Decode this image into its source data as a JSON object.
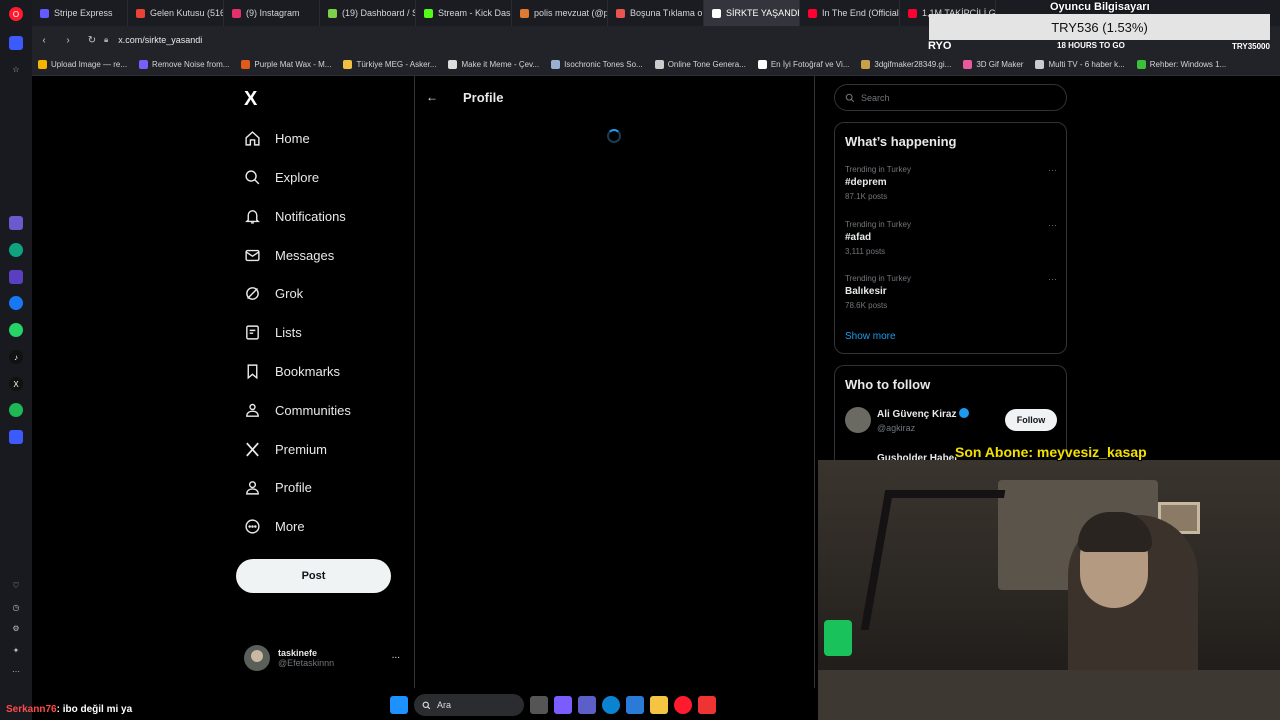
{
  "browser": {
    "tabs": [
      {
        "label": "Stripe Express",
        "color": "#635bff"
      },
      {
        "label": "Gelen Kutusu (516) -",
        "color": "#ea4335"
      },
      {
        "label": "(9) Instagram",
        "color": "#e1306c"
      },
      {
        "label": "(19) Dashboard / Str",
        "color": "#7bd148"
      },
      {
        "label": "Stream - Kick Dashbo",
        "color": "#53fc18"
      },
      {
        "label": "polis mevzuat (@poli",
        "color": "#e07a30"
      },
      {
        "label": "Boşuna Tıklama on X",
        "color": "#e8554e"
      },
      {
        "label": "SİRKTE YAŞANDI (@sirkt",
        "color": "#ffffff"
      },
      {
        "label": "In The End (Official H",
        "color": "#ff0033"
      },
      {
        "label": "1,1M TAKİPÇİLİ GLOB",
        "color": "#ff0033"
      }
    ],
    "url": "x.com/sirkte_yasandi",
    "bookmarks": [
      {
        "label": "Upload Image — re...",
        "color": "#f5b400"
      },
      {
        "label": "Remove Noise from...",
        "color": "#7a5cff"
      },
      {
        "label": "Purple Mat Wax - M...",
        "color": "#e05a1a"
      },
      {
        "label": "Türkiye MEG - Asker...",
        "color": "#f0c040"
      },
      {
        "label": "Make it Meme - Çev...",
        "color": "#dddddd"
      },
      {
        "label": "Isochronic Tones So...",
        "color": "#9ab0d0"
      },
      {
        "label": "Online Tone Genera...",
        "color": "#cccccc"
      },
      {
        "label": "En İyi Fotoğraf ve Vi...",
        "color": "#ffffff"
      },
      {
        "label": "3dgifmaker28349.gi...",
        "color": "#c8a04a"
      },
      {
        "label": "3D Gif Maker",
        "color": "#e85a9a"
      },
      {
        "label": "Multi TV - 6 haber k...",
        "color": "#cccccc"
      },
      {
        "label": "Rehber: Windows 1...",
        "color": "#3ac03a"
      }
    ]
  },
  "nav": {
    "logo": "X",
    "items": [
      "Home",
      "Explore",
      "Notifications",
      "Messages",
      "Grok",
      "Lists",
      "Bookmarks",
      "Communities",
      "Premium",
      "Profile",
      "More"
    ],
    "post_label": "Post",
    "account": {
      "name": "taskinefe",
      "handle": "@Efetaskinnn",
      "more": "..."
    }
  },
  "main": {
    "back": "←",
    "title": "Profile"
  },
  "sidebar": {
    "search_placeholder": "Search",
    "happening_title": "What’s happening",
    "trends": [
      {
        "context": "Trending in Turkey",
        "name": "#deprem",
        "count": "87.1K posts"
      },
      {
        "context": "Trending in Turkey",
        "name": "#afad",
        "count": "3,111 posts"
      },
      {
        "context": "Trending in Turkey",
        "name": "Balıkesir",
        "count": "78.6K posts"
      }
    ],
    "trend_more": "···",
    "show_more": "Show more",
    "who_title": "Who to follow",
    "follow": [
      {
        "name": "Ali Güvenç Kiraz",
        "handle": "@agkiraz",
        "button": "Follow"
      },
      {
        "name": "Gusholder Haber"
      }
    ]
  },
  "overlay": {
    "price": "TRY536 (1.53%)",
    "channel": "Oyuncu Bilgisayarı",
    "goal_left": "RYO",
    "goal_mid": "18 HOURS TO GO",
    "goal_right": "TRY35000",
    "last_sub": "Son Abone: meyvesiz_kasap"
  },
  "chat": {
    "user": "Serkann76",
    "message": ": ibo değil mi ya"
  },
  "taskbar": {
    "search_label": "Ara"
  },
  "colors": {
    "accent": "#1d9bf0",
    "border": "#2f3336",
    "muted": "#71767b"
  }
}
